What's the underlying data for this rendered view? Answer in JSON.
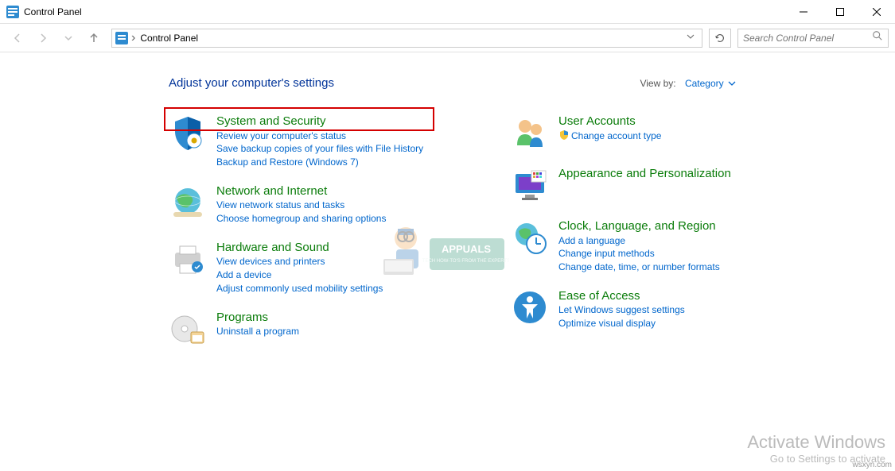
{
  "window": {
    "title": "Control Panel"
  },
  "nav": {
    "breadcrumb_separator": "›",
    "breadcrumb": "Control Panel",
    "search_placeholder": "Search Control Panel"
  },
  "header": {
    "heading": "Adjust your computer's settings",
    "viewby_label": "View by:",
    "viewby_value": "Category"
  },
  "left_col": [
    {
      "title": "System and Security",
      "links": [
        "Review your computer's status",
        "Save backup copies of your files with File History",
        "Backup and Restore (Windows 7)"
      ],
      "highlighted": true
    },
    {
      "title": "Network and Internet",
      "links": [
        "View network status and tasks",
        "Choose homegroup and sharing options"
      ]
    },
    {
      "title": "Hardware and Sound",
      "links": [
        "View devices and printers",
        "Add a device",
        "Adjust commonly used mobility settings"
      ]
    },
    {
      "title": "Programs",
      "links": [
        "Uninstall a program"
      ]
    }
  ],
  "right_col": [
    {
      "title": "User Accounts",
      "links": [
        "Change account type"
      ],
      "shield": true
    },
    {
      "title": "Appearance and Personalization",
      "links": []
    },
    {
      "title": "Clock, Language, and Region",
      "links": [
        "Add a language",
        "Change input methods",
        "Change date, time, or number formats"
      ]
    },
    {
      "title": "Ease of Access",
      "links": [
        "Let Windows suggest settings",
        "Optimize visual display"
      ]
    }
  ],
  "activate": {
    "title": "Activate Windows",
    "sub": "Go to Settings to activate"
  },
  "corner": "wsxyn.com"
}
